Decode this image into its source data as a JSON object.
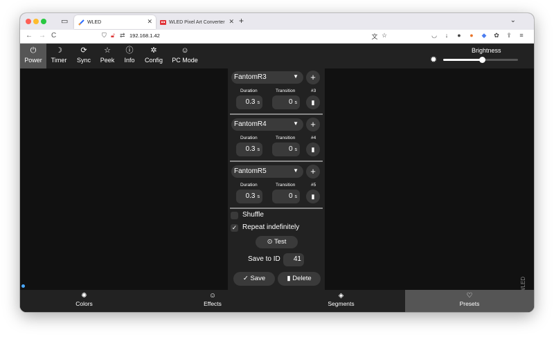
{
  "browser": {
    "tabs": [
      {
        "title": "WLED",
        "active": true
      },
      {
        "title": "WLED Pixel Art Converter",
        "active": false
      }
    ],
    "url": "192.168.1.42"
  },
  "app": {
    "topnav": [
      {
        "label": "Power",
        "icon": "power-icon"
      },
      {
        "label": "Timer",
        "icon": "moon-icon"
      },
      {
        "label": "Sync",
        "icon": "sync-icon"
      },
      {
        "label": "Peek",
        "icon": "star-icon"
      },
      {
        "label": "Info",
        "icon": "info-icon"
      },
      {
        "label": "Config",
        "icon": "gear-icon"
      },
      {
        "label": "PC Mode",
        "icon": "smiley-icon"
      }
    ],
    "brightness": {
      "label": "Brightness",
      "value": 0.52
    },
    "presets": [
      {
        "name": "FantomR3",
        "duration": "0.3",
        "transition": "0",
        "id": "#3"
      },
      {
        "name": "FantomR4",
        "duration": "0.3",
        "transition": "0",
        "id": "#4"
      },
      {
        "name": "FantomR5",
        "duration": "0.3",
        "transition": "0",
        "id": "#5"
      }
    ],
    "labels": {
      "duration": "Duration",
      "transition": "Transition",
      "unit": "s",
      "shuffle": "Shuffle",
      "repeat": "Repeat indefinitely",
      "test": "Test",
      "save_to": "Save to ID",
      "save": "Save",
      "delete": "Delete",
      "brand": "WLED"
    },
    "shuffle_checked": false,
    "repeat_checked": true,
    "save_id": "41",
    "bottomnav": [
      {
        "label": "Colors",
        "icon": "palette-icon"
      },
      {
        "label": "Effects",
        "icon": "smiley-icon"
      },
      {
        "label": "Segments",
        "icon": "layers-icon"
      },
      {
        "label": "Presets",
        "icon": "heart-icon"
      }
    ],
    "colors": {
      "accent": "#ffffff",
      "bg": "#111111",
      "panel": "#222222",
      "active": "#555555"
    }
  }
}
